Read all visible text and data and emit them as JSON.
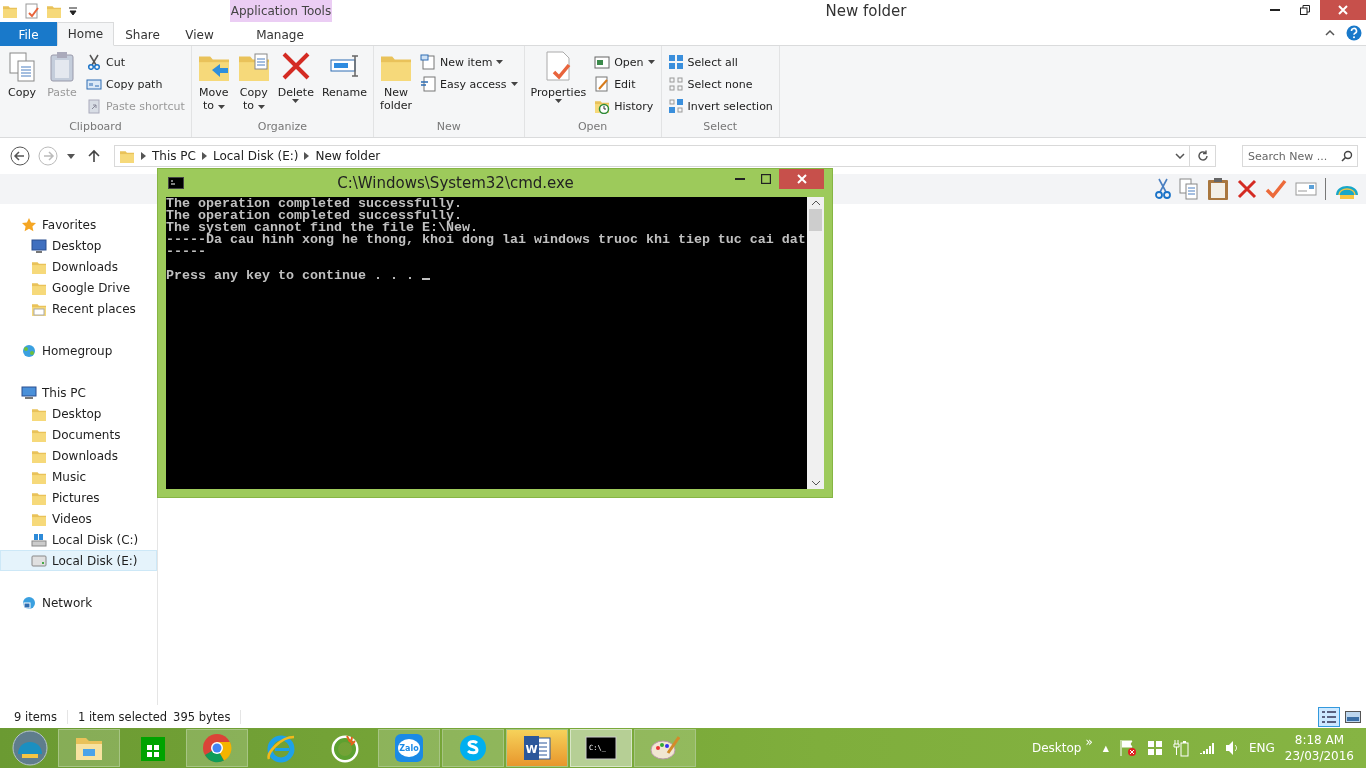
{
  "window": {
    "title": "New folder",
    "context_tab": "Application Tools"
  },
  "ribbon_tabs": [
    {
      "label": "File",
      "kind": "file",
      "selected": false
    },
    {
      "label": "Home",
      "kind": "tab",
      "selected": true
    },
    {
      "label": "Share",
      "kind": "tab",
      "selected": false
    },
    {
      "label": "View",
      "kind": "tab",
      "selected": false
    },
    {
      "label": "Manage",
      "kind": "context",
      "selected": false
    }
  ],
  "ribbon_groups": [
    {
      "label": "Clipboard",
      "columns": [
        {
          "kind": "large",
          "lines": [
            "Copy"
          ],
          "dropdown": false,
          "disabled": false
        },
        {
          "kind": "large",
          "lines": [
            "Paste"
          ],
          "dropdown": false,
          "disabled": true
        },
        {
          "kind": "stack",
          "items": [
            {
              "label": "Cut",
              "dropdown": false,
              "disabled": false
            },
            {
              "label": "Copy path",
              "dropdown": false,
              "disabled": false
            },
            {
              "label": "Paste shortcut",
              "dropdown": false,
              "disabled": true
            }
          ]
        }
      ]
    },
    {
      "label": "Organize",
      "columns": [
        {
          "kind": "large",
          "lines": [
            "Move",
            "to"
          ],
          "dropdown": true,
          "disabled": false
        },
        {
          "kind": "large",
          "lines": [
            "Copy",
            "to"
          ],
          "dropdown": true,
          "disabled": false
        },
        {
          "kind": "large",
          "lines": [
            "Delete"
          ],
          "dropdown": true,
          "disabled": false
        },
        {
          "kind": "large",
          "lines": [
            "Rename"
          ],
          "dropdown": false,
          "disabled": false
        }
      ]
    },
    {
      "label": "New",
      "columns": [
        {
          "kind": "large",
          "lines": [
            "New",
            "folder"
          ],
          "dropdown": false,
          "disabled": false
        },
        {
          "kind": "stack",
          "items": [
            {
              "label": "New item",
              "dropdown": true,
              "disabled": false
            },
            {
              "label": "Easy access",
              "dropdown": true,
              "disabled": false
            }
          ]
        }
      ]
    },
    {
      "label": "Open",
      "columns": [
        {
          "kind": "large",
          "lines": [
            "Properties"
          ],
          "dropdown": true,
          "disabled": false
        },
        {
          "kind": "stack",
          "items": [
            {
              "label": "Open",
              "dropdown": true,
              "disabled": false
            },
            {
              "label": "Edit",
              "dropdown": false,
              "disabled": false
            },
            {
              "label": "History",
              "dropdown": false,
              "disabled": false
            }
          ]
        }
      ]
    },
    {
      "label": "Select",
      "columns": [
        {
          "kind": "stack",
          "items": [
            {
              "label": "Select all",
              "dropdown": false,
              "disabled": false
            },
            {
              "label": "Select none",
              "dropdown": false,
              "disabled": false
            },
            {
              "label": "Invert selection",
              "dropdown": false,
              "disabled": false
            }
          ]
        }
      ]
    }
  ],
  "address": {
    "path": [
      "This PC",
      "Local Disk (E:)",
      "New folder"
    ],
    "search_placeholder": "Search New ..."
  },
  "navigation": [
    {
      "label": "Favorites",
      "selected": false,
      "children": [
        {
          "label": "Desktop",
          "selected": false
        },
        {
          "label": "Downloads",
          "selected": false
        },
        {
          "label": "Google Drive",
          "selected": false
        },
        {
          "label": "Recent places",
          "selected": false
        }
      ]
    },
    {
      "label": "Homegroup",
      "selected": false
    },
    {
      "label": "This PC",
      "selected": false,
      "children": [
        {
          "label": "Desktop",
          "selected": false
        },
        {
          "label": "Documents",
          "selected": false
        },
        {
          "label": "Downloads",
          "selected": false
        },
        {
          "label": "Music",
          "selected": false
        },
        {
          "label": "Pictures",
          "selected": false
        },
        {
          "label": "Videos",
          "selected": false
        },
        {
          "label": "Local Disk (C:)",
          "selected": false
        },
        {
          "label": "Local Disk (E:)",
          "selected": true
        }
      ]
    },
    {
      "label": "Network",
      "selected": false
    }
  ],
  "status_bar": {
    "items": "9 items",
    "selection": "1 item selected",
    "size": "395 bytes",
    "views": [
      {
        "kind": "details",
        "selected": true
      },
      {
        "kind": "large-icons",
        "selected": false
      }
    ]
  },
  "console": {
    "title": "C:\\Windows\\System32\\cmd.exe",
    "lines": [
      "The operation completed successfully.",
      "The operation completed successfully.",
      "The system cannot find the file E:\\New.",
      "-----Da cau hinh xong he thong, khoi dong lai windows truoc khi tiep tuc cai dat",
      "-----"
    ],
    "prompt": "Press any key to continue . . . ",
    "cursor": true
  },
  "taskbar": {
    "apps": [
      {
        "selected": false,
        "running": true
      },
      {
        "selected": false,
        "running": false
      },
      {
        "selected": false,
        "running": true
      },
      {
        "selected": false,
        "running": false
      },
      {
        "selected": false,
        "running": false
      },
      {
        "label": "Zalo",
        "selected": false,
        "running": true
      },
      {
        "selected": false,
        "running": true
      },
      {
        "label": "W",
        "selected": false,
        "running": true,
        "flashing": true
      },
      {
        "label": "C:\\_",
        "selected": true,
        "running": true
      },
      {
        "selected": false,
        "running": true
      }
    ],
    "toolbar_label": "Desktop",
    "toolbar_more": "»",
    "tray_up": "▲",
    "language": "ENG",
    "time": "8:18 AM",
    "date": "23/03/2016"
  }
}
